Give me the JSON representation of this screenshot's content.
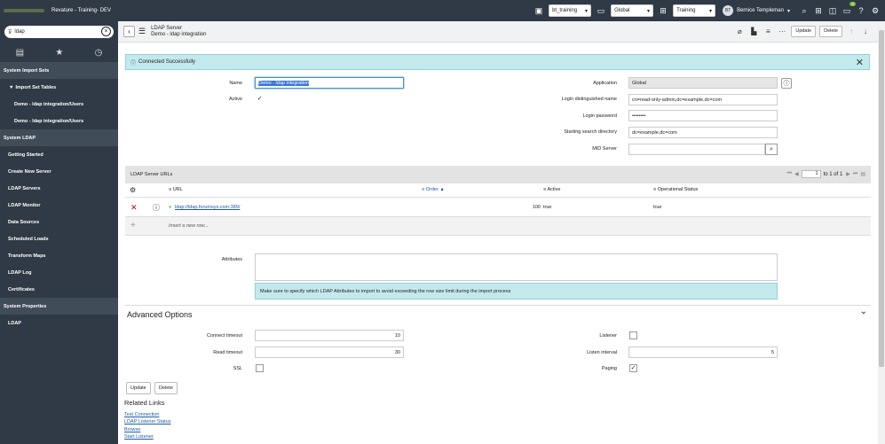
{
  "header": {
    "instance_title": "Revature - Training- DEV",
    "update_set": "bt_training",
    "application": "Global",
    "domain": "Training",
    "user_initials": "BT",
    "user_name": "Bernice Templeman",
    "notification_count": "0"
  },
  "nav": {
    "filter_value": "ldap",
    "items": [
      {
        "label": "System Import Sets",
        "kind": "sec"
      },
      {
        "label": "Import Set Tables",
        "kind": "sub"
      },
      {
        "label": "Demo - ldap integration/Users",
        "kind": "sub2"
      },
      {
        "label": "Demo - ldap integration/Users",
        "kind": "sub2"
      },
      {
        "label": "System LDAP",
        "kind": "sec"
      },
      {
        "label": "Getting Started",
        "kind": "mod"
      },
      {
        "label": "Create New Server",
        "kind": "mod"
      },
      {
        "label": "LDAP Servers",
        "kind": "mod"
      },
      {
        "label": "LDAP Monitor",
        "kind": "mod"
      },
      {
        "label": "Data Sources",
        "kind": "mod"
      },
      {
        "label": "Scheduled Loads",
        "kind": "mod"
      },
      {
        "label": "Transform Maps",
        "kind": "mod"
      },
      {
        "label": "LDAP Log",
        "kind": "mod"
      },
      {
        "label": "Certificates",
        "kind": "mod"
      },
      {
        "label": "System Properties",
        "kind": "sec"
      },
      {
        "label": "LDAP",
        "kind": "mod"
      }
    ]
  },
  "form": {
    "table_label": "LDAP Server",
    "record_title": "Demo - ldap integration",
    "update_label": "Update",
    "delete_label": "Delete",
    "message": "Connected Successfully",
    "fields": {
      "name_label": "Name",
      "name_value": "Demo - ldap integration",
      "active_label": "Active",
      "application_label": "Application",
      "application_value": "Global",
      "login_dn_label": "Login distinguished name",
      "login_dn_value": "cn=read-only-admin,dc=example,dc=com",
      "login_password_label": "Login password",
      "login_password_value": "••••••••",
      "search_dir_label": "Starting search directory",
      "search_dir_value": "dc=example,dc=com",
      "mid_server_label": "MID Server",
      "mid_server_value": ""
    },
    "related_list": {
      "title": "LDAP Server URLs",
      "page_value": "1",
      "page_total": "to 1 of 1",
      "columns": [
        "URL",
        "Order",
        "Active",
        "Operational Status"
      ],
      "row": {
        "url": "ldap://ldap.forumsys.com:389/",
        "order": "100",
        "active": "true",
        "status": "true"
      },
      "insert_label": "Insert a new row..."
    },
    "attributes_label": "Attributes",
    "attributes_hint": "Make sure to specify which LDAP Attributes to import to avoid exceeding the row size limit during the import process",
    "advanced": {
      "title": "Advanced Options",
      "connect_timeout_label": "Connect timeout",
      "connect_timeout_value": "10",
      "read_timeout_label": "Read timeout",
      "read_timeout_value": "30",
      "ssl_label": "SSL",
      "listener_label": "Listener",
      "listen_interval_label": "Listen interval",
      "listen_interval_value": "5",
      "paging_label": "Paging"
    },
    "related_links_title": "Related Links",
    "related_links": [
      "Test Connection",
      "LDAP Listener Status",
      "Browse",
      "Start Listener"
    ]
  }
}
